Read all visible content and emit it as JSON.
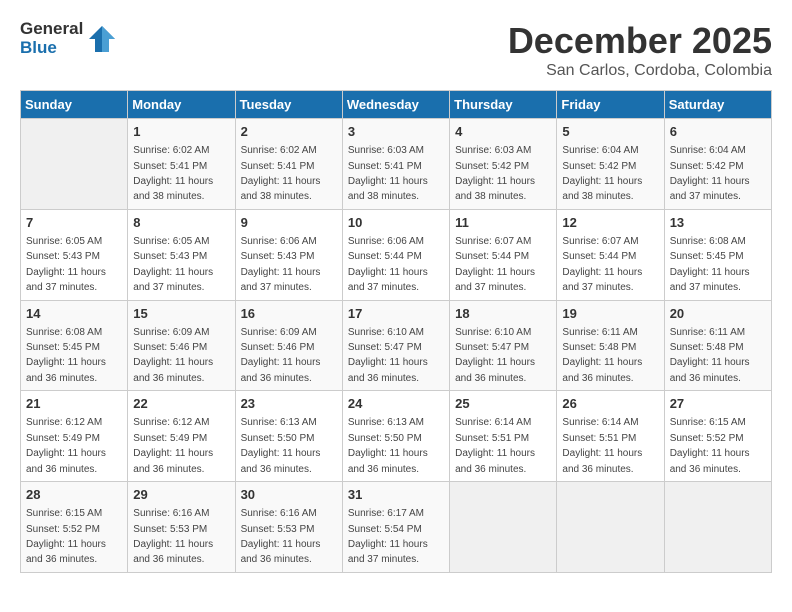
{
  "header": {
    "logo_general": "General",
    "logo_blue": "Blue",
    "month_title": "December 2025",
    "location": "San Carlos, Cordoba, Colombia"
  },
  "calendar": {
    "days_of_week": [
      "Sunday",
      "Monday",
      "Tuesday",
      "Wednesday",
      "Thursday",
      "Friday",
      "Saturday"
    ],
    "weeks": [
      [
        {
          "day": "",
          "sunrise": "",
          "sunset": "",
          "daylight": ""
        },
        {
          "day": "1",
          "sunrise": "Sunrise: 6:02 AM",
          "sunset": "Sunset: 5:41 PM",
          "daylight": "Daylight: 11 hours and 38 minutes."
        },
        {
          "day": "2",
          "sunrise": "Sunrise: 6:02 AM",
          "sunset": "Sunset: 5:41 PM",
          "daylight": "Daylight: 11 hours and 38 minutes."
        },
        {
          "day": "3",
          "sunrise": "Sunrise: 6:03 AM",
          "sunset": "Sunset: 5:41 PM",
          "daylight": "Daylight: 11 hours and 38 minutes."
        },
        {
          "day": "4",
          "sunrise": "Sunrise: 6:03 AM",
          "sunset": "Sunset: 5:42 PM",
          "daylight": "Daylight: 11 hours and 38 minutes."
        },
        {
          "day": "5",
          "sunrise": "Sunrise: 6:04 AM",
          "sunset": "Sunset: 5:42 PM",
          "daylight": "Daylight: 11 hours and 38 minutes."
        },
        {
          "day": "6",
          "sunrise": "Sunrise: 6:04 AM",
          "sunset": "Sunset: 5:42 PM",
          "daylight": "Daylight: 11 hours and 37 minutes."
        }
      ],
      [
        {
          "day": "7",
          "sunrise": "Sunrise: 6:05 AM",
          "sunset": "Sunset: 5:43 PM",
          "daylight": "Daylight: 11 hours and 37 minutes."
        },
        {
          "day": "8",
          "sunrise": "Sunrise: 6:05 AM",
          "sunset": "Sunset: 5:43 PM",
          "daylight": "Daylight: 11 hours and 37 minutes."
        },
        {
          "day": "9",
          "sunrise": "Sunrise: 6:06 AM",
          "sunset": "Sunset: 5:43 PM",
          "daylight": "Daylight: 11 hours and 37 minutes."
        },
        {
          "day": "10",
          "sunrise": "Sunrise: 6:06 AM",
          "sunset": "Sunset: 5:44 PM",
          "daylight": "Daylight: 11 hours and 37 minutes."
        },
        {
          "day": "11",
          "sunrise": "Sunrise: 6:07 AM",
          "sunset": "Sunset: 5:44 PM",
          "daylight": "Daylight: 11 hours and 37 minutes."
        },
        {
          "day": "12",
          "sunrise": "Sunrise: 6:07 AM",
          "sunset": "Sunset: 5:44 PM",
          "daylight": "Daylight: 11 hours and 37 minutes."
        },
        {
          "day": "13",
          "sunrise": "Sunrise: 6:08 AM",
          "sunset": "Sunset: 5:45 PM",
          "daylight": "Daylight: 11 hours and 37 minutes."
        }
      ],
      [
        {
          "day": "14",
          "sunrise": "Sunrise: 6:08 AM",
          "sunset": "Sunset: 5:45 PM",
          "daylight": "Daylight: 11 hours and 36 minutes."
        },
        {
          "day": "15",
          "sunrise": "Sunrise: 6:09 AM",
          "sunset": "Sunset: 5:46 PM",
          "daylight": "Daylight: 11 hours and 36 minutes."
        },
        {
          "day": "16",
          "sunrise": "Sunrise: 6:09 AM",
          "sunset": "Sunset: 5:46 PM",
          "daylight": "Daylight: 11 hours and 36 minutes."
        },
        {
          "day": "17",
          "sunrise": "Sunrise: 6:10 AM",
          "sunset": "Sunset: 5:47 PM",
          "daylight": "Daylight: 11 hours and 36 minutes."
        },
        {
          "day": "18",
          "sunrise": "Sunrise: 6:10 AM",
          "sunset": "Sunset: 5:47 PM",
          "daylight": "Daylight: 11 hours and 36 minutes."
        },
        {
          "day": "19",
          "sunrise": "Sunrise: 6:11 AM",
          "sunset": "Sunset: 5:48 PM",
          "daylight": "Daylight: 11 hours and 36 minutes."
        },
        {
          "day": "20",
          "sunrise": "Sunrise: 6:11 AM",
          "sunset": "Sunset: 5:48 PM",
          "daylight": "Daylight: 11 hours and 36 minutes."
        }
      ],
      [
        {
          "day": "21",
          "sunrise": "Sunrise: 6:12 AM",
          "sunset": "Sunset: 5:49 PM",
          "daylight": "Daylight: 11 hours and 36 minutes."
        },
        {
          "day": "22",
          "sunrise": "Sunrise: 6:12 AM",
          "sunset": "Sunset: 5:49 PM",
          "daylight": "Daylight: 11 hours and 36 minutes."
        },
        {
          "day": "23",
          "sunrise": "Sunrise: 6:13 AM",
          "sunset": "Sunset: 5:50 PM",
          "daylight": "Daylight: 11 hours and 36 minutes."
        },
        {
          "day": "24",
          "sunrise": "Sunrise: 6:13 AM",
          "sunset": "Sunset: 5:50 PM",
          "daylight": "Daylight: 11 hours and 36 minutes."
        },
        {
          "day": "25",
          "sunrise": "Sunrise: 6:14 AM",
          "sunset": "Sunset: 5:51 PM",
          "daylight": "Daylight: 11 hours and 36 minutes."
        },
        {
          "day": "26",
          "sunrise": "Sunrise: 6:14 AM",
          "sunset": "Sunset: 5:51 PM",
          "daylight": "Daylight: 11 hours and 36 minutes."
        },
        {
          "day": "27",
          "sunrise": "Sunrise: 6:15 AM",
          "sunset": "Sunset: 5:52 PM",
          "daylight": "Daylight: 11 hours and 36 minutes."
        }
      ],
      [
        {
          "day": "28",
          "sunrise": "Sunrise: 6:15 AM",
          "sunset": "Sunset: 5:52 PM",
          "daylight": "Daylight: 11 hours and 36 minutes."
        },
        {
          "day": "29",
          "sunrise": "Sunrise: 6:16 AM",
          "sunset": "Sunset: 5:53 PM",
          "daylight": "Daylight: 11 hours and 36 minutes."
        },
        {
          "day": "30",
          "sunrise": "Sunrise: 6:16 AM",
          "sunset": "Sunset: 5:53 PM",
          "daylight": "Daylight: 11 hours and 36 minutes."
        },
        {
          "day": "31",
          "sunrise": "Sunrise: 6:17 AM",
          "sunset": "Sunset: 5:54 PM",
          "daylight": "Daylight: 11 hours and 37 minutes."
        },
        {
          "day": "",
          "sunrise": "",
          "sunset": "",
          "daylight": ""
        },
        {
          "day": "",
          "sunrise": "",
          "sunset": "",
          "daylight": ""
        },
        {
          "day": "",
          "sunrise": "",
          "sunset": "",
          "daylight": ""
        }
      ]
    ]
  }
}
